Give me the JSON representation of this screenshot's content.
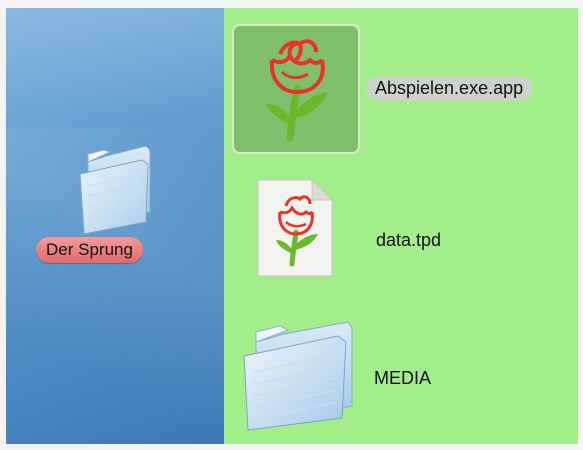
{
  "desktop": {
    "folder_label": "Der Sprung"
  },
  "finder": {
    "items": [
      {
        "label": "Abspielen.exe.app",
        "icon": "rose-app-icon",
        "selected": true
      },
      {
        "label": "data.tpd",
        "icon": "rose-document-icon",
        "selected": false
      },
      {
        "label": "MEDIA",
        "icon": "folder-icon",
        "selected": false
      }
    ]
  },
  "colors": {
    "desktop_blue": "#5f9acd",
    "finder_green": "#a3ee8b",
    "selection_green": "#80c06c",
    "label_red": "#e46a6a",
    "rose_red": "#e8322a",
    "stem_green": "#6ab82c"
  }
}
